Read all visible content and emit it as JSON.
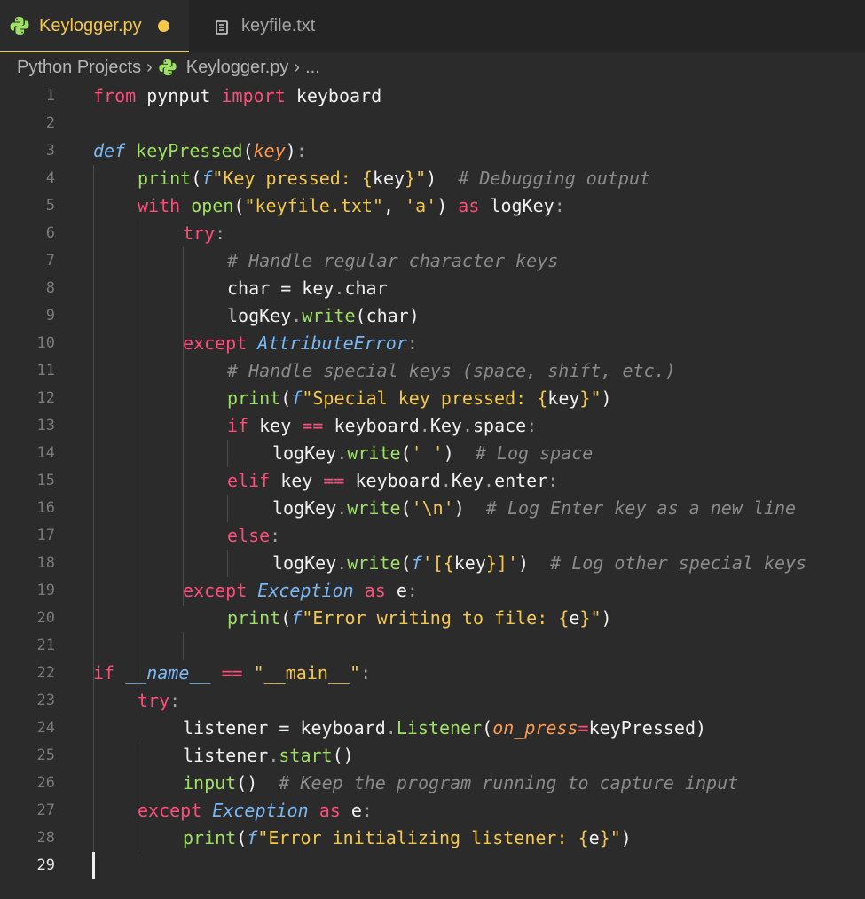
{
  "tabs": [
    {
      "label": "Keylogger.py",
      "icon": "python-file-icon",
      "modified": true,
      "active": true
    },
    {
      "label": "keyfile.txt",
      "icon": "text-file-icon",
      "active": false
    }
  ],
  "breadcrumb": {
    "folder": "Python Projects",
    "file": "Keylogger.py",
    "more": "..."
  },
  "colors": {
    "keyword": "#ff4d79",
    "function": "#9ee063",
    "string": "#f4c84a",
    "comment": "#8a8a8a",
    "class": "#7ab8f5",
    "parameter": "#ff9a4d"
  },
  "editor": {
    "current_line": 29,
    "lines": [
      {
        "num": "1"
      },
      {
        "num": "2"
      },
      {
        "num": "3"
      },
      {
        "num": "4"
      },
      {
        "num": "5"
      },
      {
        "num": "6"
      },
      {
        "num": "7"
      },
      {
        "num": "8"
      },
      {
        "num": "9"
      },
      {
        "num": "10"
      },
      {
        "num": "11"
      },
      {
        "num": "12"
      },
      {
        "num": "13"
      },
      {
        "num": "14"
      },
      {
        "num": "15"
      },
      {
        "num": "16"
      },
      {
        "num": "17"
      },
      {
        "num": "18"
      },
      {
        "num": "19"
      },
      {
        "num": "20"
      },
      {
        "num": "21"
      },
      {
        "num": "22"
      },
      {
        "num": "23"
      },
      {
        "num": "24"
      },
      {
        "num": "25"
      },
      {
        "num": "26"
      },
      {
        "num": "27"
      },
      {
        "num": "28"
      },
      {
        "num": "29"
      }
    ],
    "t": {
      "from": "from",
      "pynput": "pynput",
      "import": "import",
      "keyboard": "keyboard",
      "def": "def",
      "keyPressed": "keyPressed",
      "key": "key",
      "lp": "(",
      "rp": ")",
      "colon": ":",
      "print": "print",
      "f": "f",
      "dq": "\"",
      "sq": "'",
      "key_pressed_text": "Key pressed: ",
      "lb": "{",
      "rb": "}",
      "c_debug": "# Debugging output",
      "with": "with",
      "open": "open",
      "keyfile": "\"keyfile.txt\"",
      "comma": ", ",
      "a": "'a'",
      "as": "as",
      "logKey": "logKey",
      "try": "try",
      "c_regular": "# Handle regular character keys",
      "char": "char",
      "eq": " = ",
      "dot": ".",
      "write": "write",
      "except": "except",
      "AttributeError": "AttributeError",
      "c_special": "# Handle special keys (space, shift, etc.)",
      "special_text": "Special key pressed: ",
      "if": "if",
      "eqeq": " == ",
      "Key": "Key",
      "space": "space",
      "space_str": "' '",
      "c_logspace": "# Log space",
      "elif": "elif",
      "enter": "enter",
      "nl_str": "'\\n'",
      "c_enter": "# Log Enter key as a new line",
      "else": "else",
      "bracket_open": "[",
      "bracket_close": "]",
      "c_other": "# Log other special keys",
      "Exception": "Exception",
      "e": "e",
      "err_write_text": "Error writing to file: ",
      "dunder_name": "__name__",
      "main_str": "\"__main__\"",
      "listener": "listener",
      "Listener": "Listener",
      "on_press": "on_press",
      "assign": "=",
      "start": "start",
      "input": "input",
      "empty": "()",
      "c_keep": "# Keep the program running to capture input",
      "err_init_text": "Error initializing listener: "
    }
  }
}
